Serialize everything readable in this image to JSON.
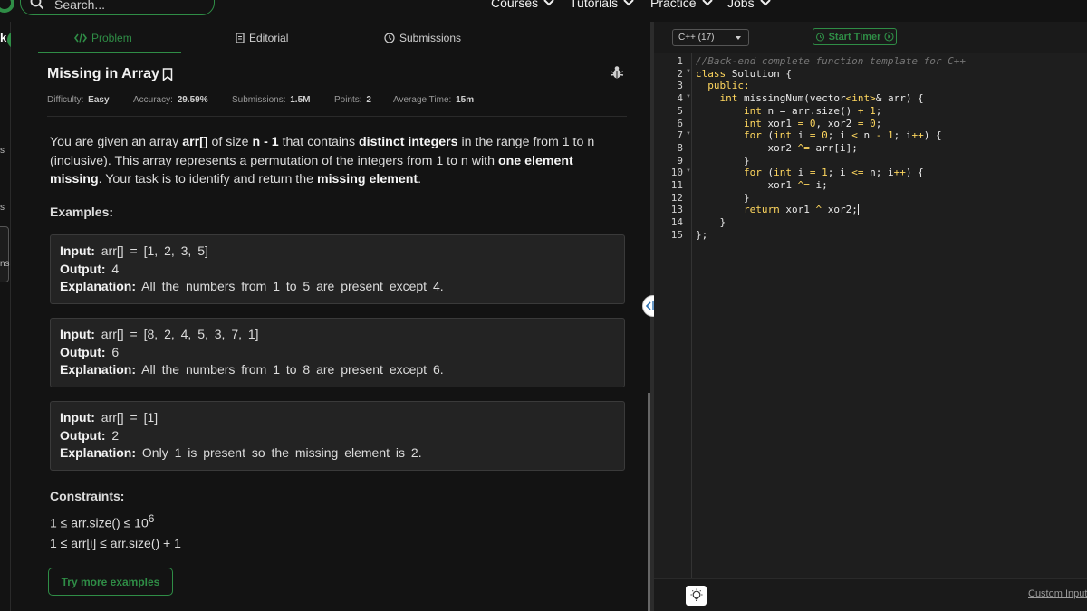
{
  "nav": {
    "search_placeholder": "Search...",
    "links": [
      "Courses",
      "Tutorials",
      "Practice",
      "Jobs"
    ]
  },
  "left_strip": {
    "letter": "k",
    "frag1": "s",
    "frag2": "s",
    "frag3": "ns"
  },
  "tabs": [
    "Problem",
    "Editorial",
    "Submissions"
  ],
  "problem": {
    "title": "Missing in Array",
    "meta": {
      "difficulty_label": "Difficulty:",
      "difficulty": "Easy",
      "accuracy_label": "Accuracy:",
      "accuracy": "29.59%",
      "submissions_label": "Submissions:",
      "submissions": "1.5M",
      "points_label": "Points:",
      "points": "2",
      "avg_time_label": "Average Time:",
      "avg_time": "15m"
    },
    "description": {
      "p1": "You are given an array ",
      "b1": "arr[]",
      "p2": " of size ",
      "b2": "n - 1",
      "p3": " that contains ",
      "b3": "distinct integers",
      "p4": " in the range from 1 to n (inclusive). This array represents a permutation of the integers from 1 to n with ",
      "b4": "one element missing",
      "p5": ". Your task is to identify and return the ",
      "b5": "missing element",
      "p6": "."
    },
    "examples_heading": "Examples:",
    "examples": [
      {
        "input_label": "Input:",
        "input": "arr[] = [1, 2, 3, 5]",
        "output_label": "Output:",
        "output": "4",
        "explanation_label": "Explanation:",
        "explanation": "All the numbers from 1 to 5 are present except 4."
      },
      {
        "input_label": "Input:",
        "input": "arr[] = [8, 2, 4, 5, 3, 7, 1]",
        "output_label": "Output:",
        "output": "6",
        "explanation_label": "Explanation:",
        "explanation": "All the numbers from 1 to 8 are present except 6."
      },
      {
        "input_label": "Input:",
        "input": "arr[] = [1]",
        "output_label": "Output:",
        "output": "2",
        "explanation_label": "Explanation:",
        "explanation": "Only 1 is present so the missing element is 2."
      }
    ],
    "constraints_heading": "Constraints:",
    "constraint1_base": "1 ≤ arr.size() ≤ 10",
    "constraint1_exp": "6",
    "constraint2": "1 ≤ arr[i] ≤ arr.size() + 1",
    "try_more": "Try more examples"
  },
  "editor": {
    "language": "C++ (17)",
    "start_timer": "Start Timer",
    "line_numbers": [
      "1",
      "2",
      "3",
      "4",
      "5",
      "6",
      "7",
      "8",
      "9",
      "10",
      "11",
      "12",
      "13",
      "14",
      "15"
    ],
    "code": {
      "l1": "//Back-end complete function template for C++",
      "l2a": "class",
      "l2b": " Solution {",
      "l3": "  public:",
      "l4a": "    int",
      "l4b": " missingNum(vector",
      "l4c": "<int>",
      "l4d": "& arr) {",
      "l5a": "        int",
      "l5b": " n = arr.size() ",
      "l5c": "+",
      "l5d": " ",
      "l5e": "1",
      "l5f": ";",
      "l6a": "        int",
      "l6b": " xor1 ",
      "l6c": "=",
      "l6d": " ",
      "l6e": "0",
      "l6f": ", xor2 ",
      "l6g": "=",
      "l6h": " ",
      "l6i": "0",
      "l6j": ";",
      "l7a": "        for",
      "l7b": " (",
      "l7c": "int",
      "l7d": " i ",
      "l7e": "=",
      "l7f": " ",
      "l7g": "0",
      "l7h": "; i ",
      "l7i": "<",
      "l7j": " n ",
      "l7k": "-",
      "l7l": " ",
      "l7m": "1",
      "l7n": "; i",
      "l7o": "++",
      "l7p": ") {",
      "l8a": "            xor2 ",
      "l8b": "^=",
      "l8c": " arr[i];",
      "l9": "        }",
      "l10a": "        for",
      "l10b": " (",
      "l10c": "int",
      "l10d": " i ",
      "l10e": "=",
      "l10f": " ",
      "l10g": "1",
      "l10h": "; i ",
      "l10i": "<=",
      "l10j": " n; i",
      "l10k": "++",
      "l10l": ") {",
      "l11a": "            xor1 ",
      "l11b": "^=",
      "l11c": " i;",
      "l12": "        }",
      "l13a": "        return",
      "l13b": " xor1 ",
      "l13c": "^",
      "l13d": " xor2;",
      "l14": "    }",
      "l15": "};"
    },
    "custom_input": "Custom Input"
  },
  "colors": {
    "accent": "#2f8d46",
    "bg": "#131313",
    "editor_bg": "#1e1e1e",
    "keyword": "#ffd75e"
  }
}
